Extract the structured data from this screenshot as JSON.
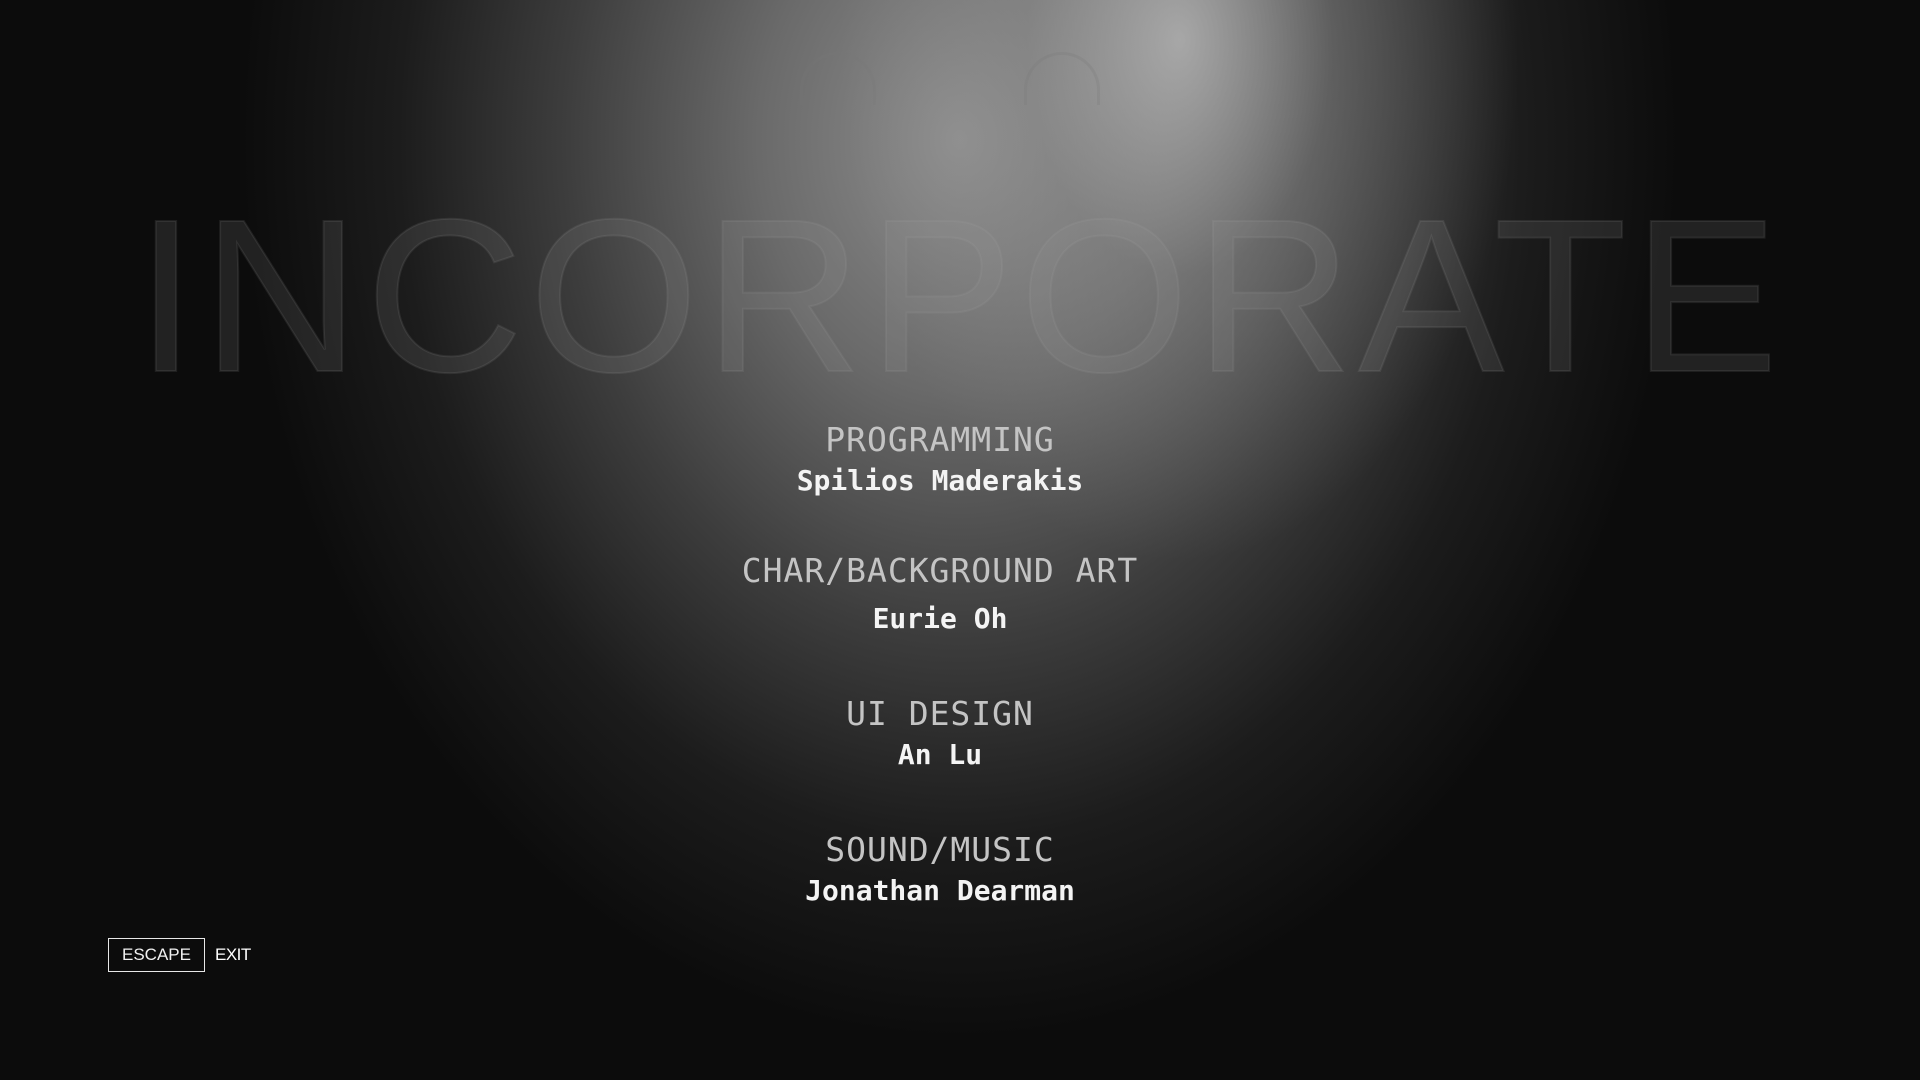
{
  "game": {
    "title": "INCORPORATE"
  },
  "credits": [
    {
      "role": "PROGRAMMING",
      "name": "Spilios Maderakis"
    },
    {
      "role": "CHAR/BACKGROUND ART",
      "name": "Eurie Oh"
    },
    {
      "role": "UI DESIGN",
      "name": "An Lu"
    },
    {
      "role": "SOUND/MUSIC",
      "name": "Jonathan Dearman"
    }
  ],
  "controls": {
    "exit_key": "ESCAPE",
    "exit_label": "EXIT"
  }
}
